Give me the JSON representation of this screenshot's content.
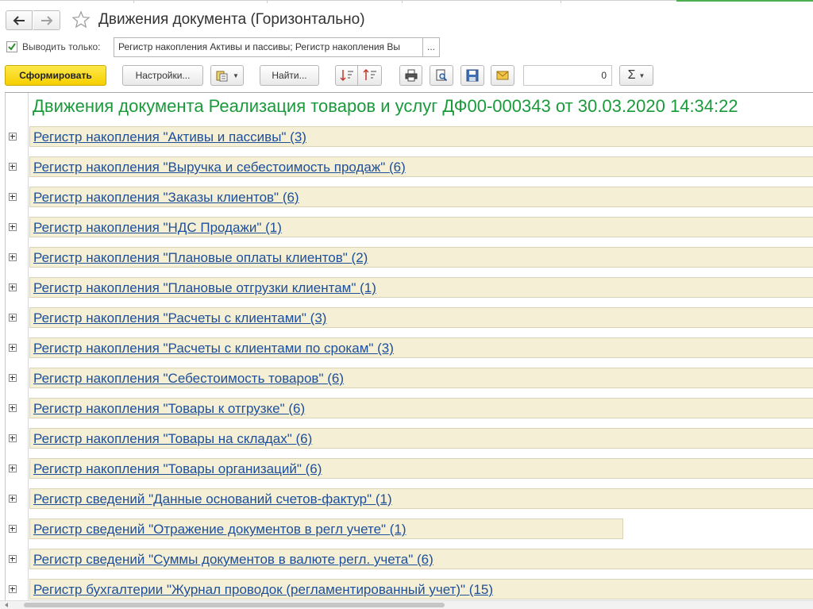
{
  "window": {
    "title": "Движения документа (Горизонтально)"
  },
  "icons": {
    "back": "arrow-left-icon",
    "forward": "arrow-right-icon",
    "favorite": "star-icon",
    "checkbox": "checkbox-checked-icon",
    "variant": "report-variant-icon",
    "sort_asc": "sort-ascending-icon",
    "sort_desc": "sort-descending-icon",
    "print": "printer-icon",
    "preview": "print-preview-icon",
    "save": "floppy-disk-icon",
    "mail": "envelope-icon",
    "sum": "sigma-icon"
  },
  "filter": {
    "label": "Выводить только:",
    "checked": true,
    "value": "Регистр накопления Активы и пассивы; Регистр накопления Вы",
    "more": "..."
  },
  "toolbar": {
    "generate": "Сформировать",
    "settings": "Настройки...",
    "find": "Найти...",
    "amount_value": "0",
    "sum_symbol": "Σ"
  },
  "colors": {
    "accent_yellow": "#f5cf00",
    "title_green": "#1a9a3a",
    "link_blue": "#1d4f9a",
    "row_fill": "#f5efd6",
    "top_accent_green": "#4caf50"
  },
  "report": {
    "title": "Движения документа Реализация товаров и услуг ДФ00-000343 от 30.03.2020 14:34:22",
    "rows": [
      {
        "label": "Регистр накопления \"Активы и пассивы\" (3)"
      },
      {
        "label": "Регистр накопления \"Выручка и себестоимость продаж\" (6)"
      },
      {
        "label": "Регистр накопления \"Заказы клиентов\" (6)"
      },
      {
        "label": "Регистр накопления \"НДС Продажи\" (1)"
      },
      {
        "label": "Регистр накопления \"Плановые оплаты клиентов\" (2)"
      },
      {
        "label": "Регистр накопления \"Плановые отгрузки клиентам\" (1)"
      },
      {
        "label": "Регистр накопления \"Расчеты с клиентами\" (3)"
      },
      {
        "label": "Регистр накопления \"Расчеты с клиентами по срокам\" (3)"
      },
      {
        "label": "Регистр накопления \"Себестоимость товаров\" (6)"
      },
      {
        "label": "Регистр накопления \"Товары к отгрузке\" (6)"
      },
      {
        "label": "Регистр накопления \"Товары на складах\" (6)"
      },
      {
        "label": "Регистр накопления \"Товары организаций\" (6)"
      },
      {
        "label": "Регистр сведений \"Данные оснований счетов-фактур\" (1)"
      },
      {
        "label": "Регистр сведений \"Отражение документов в регл учете\" (1)"
      },
      {
        "label": "Регистр сведений \"Суммы документов в валюте регл. учета\" (6)"
      },
      {
        "label": "Регистр бухгалтерии \"Журнал проводок (регламентированный учет)\" (15)"
      }
    ]
  }
}
